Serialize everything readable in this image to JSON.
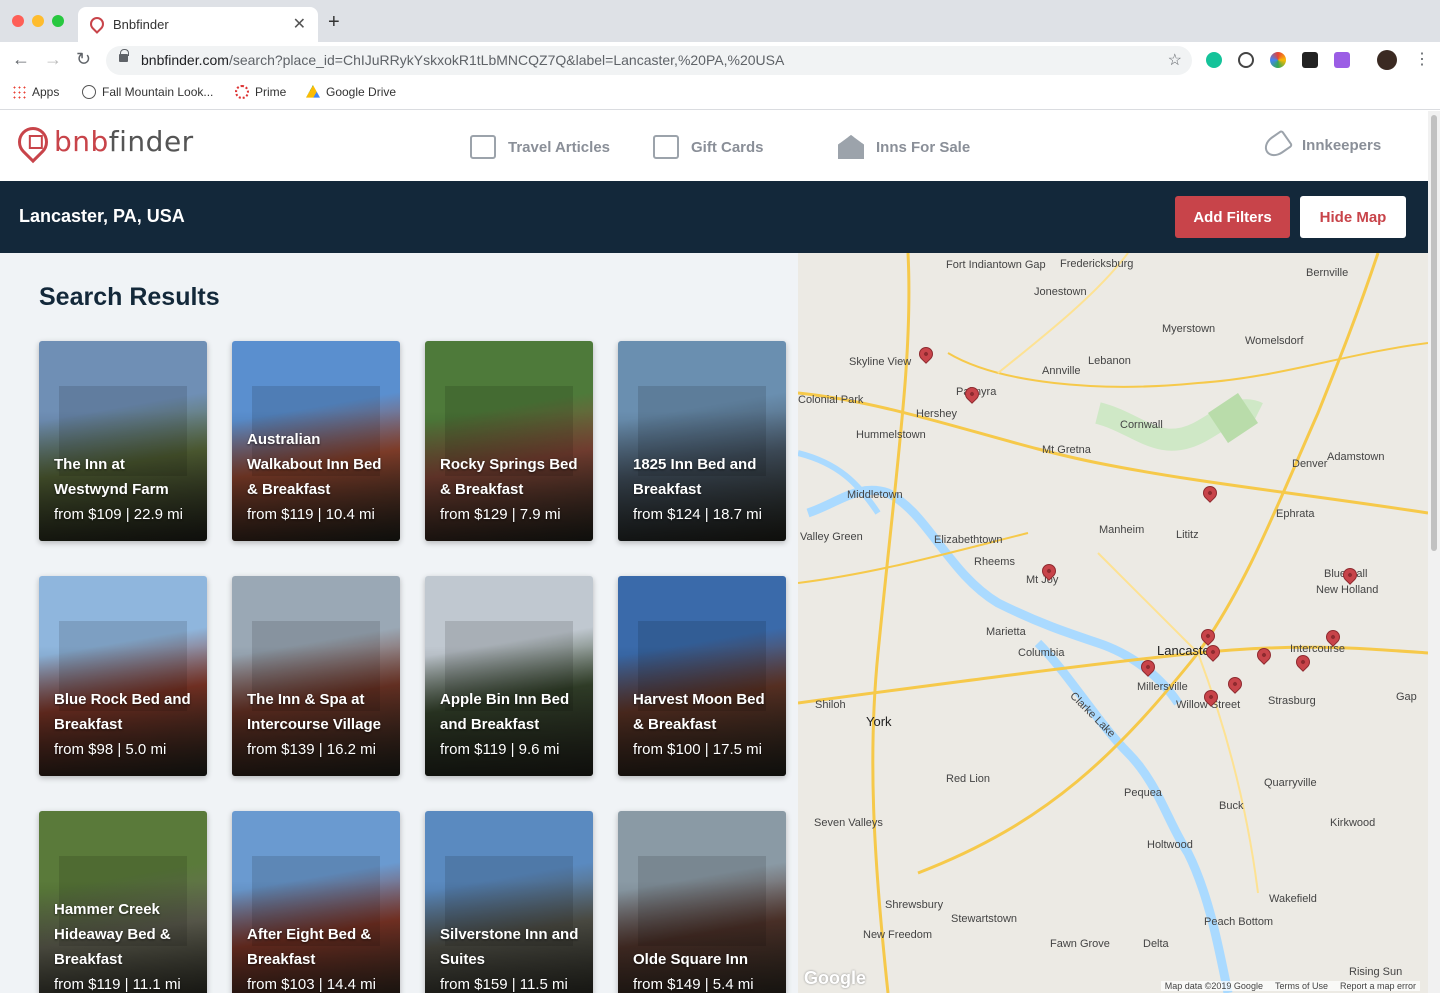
{
  "browser": {
    "tab_title": "Bnbfinder",
    "url_host": "bnbfinder.com",
    "url_path": "/search?place_id=ChIJuRRykYskxokR1tLbMNCQZ7Q&label=Lancaster,%20PA,%20USA",
    "bookmarks": [
      "Apps",
      "Fall Mountain Look...",
      "Prime",
      "Google Drive"
    ]
  },
  "header": {
    "logo_prefix": "bnb",
    "logo_suffix": "finder",
    "nav": {
      "travel": "Travel Articles",
      "gift": "Gift Cards",
      "inns": "Inns For Sale",
      "keepers": "Innkeepers"
    }
  },
  "search": {
    "location": "Lancaster, PA, USA",
    "add_filters": "Add Filters",
    "hide_map": "Hide Map"
  },
  "results": {
    "title": "Search Results",
    "items": [
      {
        "name": "The Inn at Westwynd Farm",
        "price": "from $109 | 22.9 mi",
        "colors": [
          "#6f8fb5",
          "#5b6b3a"
        ]
      },
      {
        "name": "Australian Walkabout Inn Bed & Breakfast",
        "price": "from $119 | 10.4 mi",
        "colors": [
          "#5a8fcf",
          "#9b4a32"
        ]
      },
      {
        "name": "Rocky Springs Bed & Breakfast",
        "price": "from $129 | 7.9 mi",
        "colors": [
          "#4e7a3a",
          "#8a4a3a"
        ]
      },
      {
        "name": "1825 Inn Bed and Breakfast",
        "price": "from $124 | 18.7 mi",
        "colors": [
          "#6a8fb0",
          "#4a5a6a"
        ]
      },
      {
        "name": "Blue Rock Bed and Breakfast",
        "price": "from $98 | 5.0 mi",
        "colors": [
          "#8fb6dd",
          "#8a3a2a"
        ]
      },
      {
        "name": "The Inn & Spa at Intercourse Village",
        "price": "from $139 | 16.2 mi",
        "colors": [
          "#9aa8b5",
          "#7a3a2a"
        ]
      },
      {
        "name": "Apple Bin Inn Bed and Breakfast",
        "price": "from $119 | 9.6 mi",
        "colors": [
          "#c0c8d0",
          "#3a4a30"
        ]
      },
      {
        "name": "Harvest Moon Bed & Breakfast",
        "price": "from $100 | 17.5 mi",
        "colors": [
          "#3a6aaa",
          "#6a3a2a"
        ]
      },
      {
        "name": "Hammer Creek Hideaway Bed & Breakfast",
        "price": "from $119 | 11.1 mi",
        "colors": [
          "#5a7a3a",
          "#6a6a5a"
        ]
      },
      {
        "name": "After Eight Bed & Breakfast",
        "price": "from $103 | 14.4 mi",
        "colors": [
          "#6a9ad0",
          "#8a3a2a"
        ]
      },
      {
        "name": "Silverstone Inn and Suites",
        "price": "from $159 | 11.5 mi",
        "colors": [
          "#5a8ac0",
          "#5a5a50"
        ]
      },
      {
        "name": "Olde Square Inn",
        "price": "from $149 | 5.4 mi",
        "colors": [
          "#8a9aa5",
          "#5a3a30"
        ]
      }
    ]
  },
  "map": {
    "labels": [
      "Fort Indiantown Gap",
      "Fredericksburg",
      "Bernville",
      "Jonestown",
      "Myerstown",
      "Womelsdorf",
      "Skyline View",
      "Lebanon",
      "Annville",
      "Palmyra",
      "Colonial Park",
      "Hershey",
      "Cornwall",
      "Hummelstown",
      "Mt Gretna",
      "Denver",
      "Adamstown",
      "Middletown",
      "Ephrata",
      "Manheim",
      "Lititz",
      "Valley Green",
      "Elizabethtown",
      "Rheems",
      "Mt Joy",
      "Blue Ball",
      "New Holland",
      "Marietta",
      "Columbia",
      "Lancaster",
      "Intercourse",
      "Millersville",
      "Willow Street",
      "Strasburg",
      "Gap",
      "Shiloh",
      "York",
      "Clarke Lake",
      "Red Lion",
      "Quarryville",
      "Pequea",
      "Buck",
      "Seven Valleys",
      "Kirkwood",
      "Holtwood",
      "Wakefield",
      "Shrewsbury",
      "Stewartstown",
      "Peach Bottom",
      "New Freedom",
      "Fawn Grove",
      "Delta",
      "Rising Sun"
    ],
    "attribution": [
      "Map data ©2019 Google",
      "Terms of Use",
      "Report a map error"
    ],
    "google": "Google"
  }
}
